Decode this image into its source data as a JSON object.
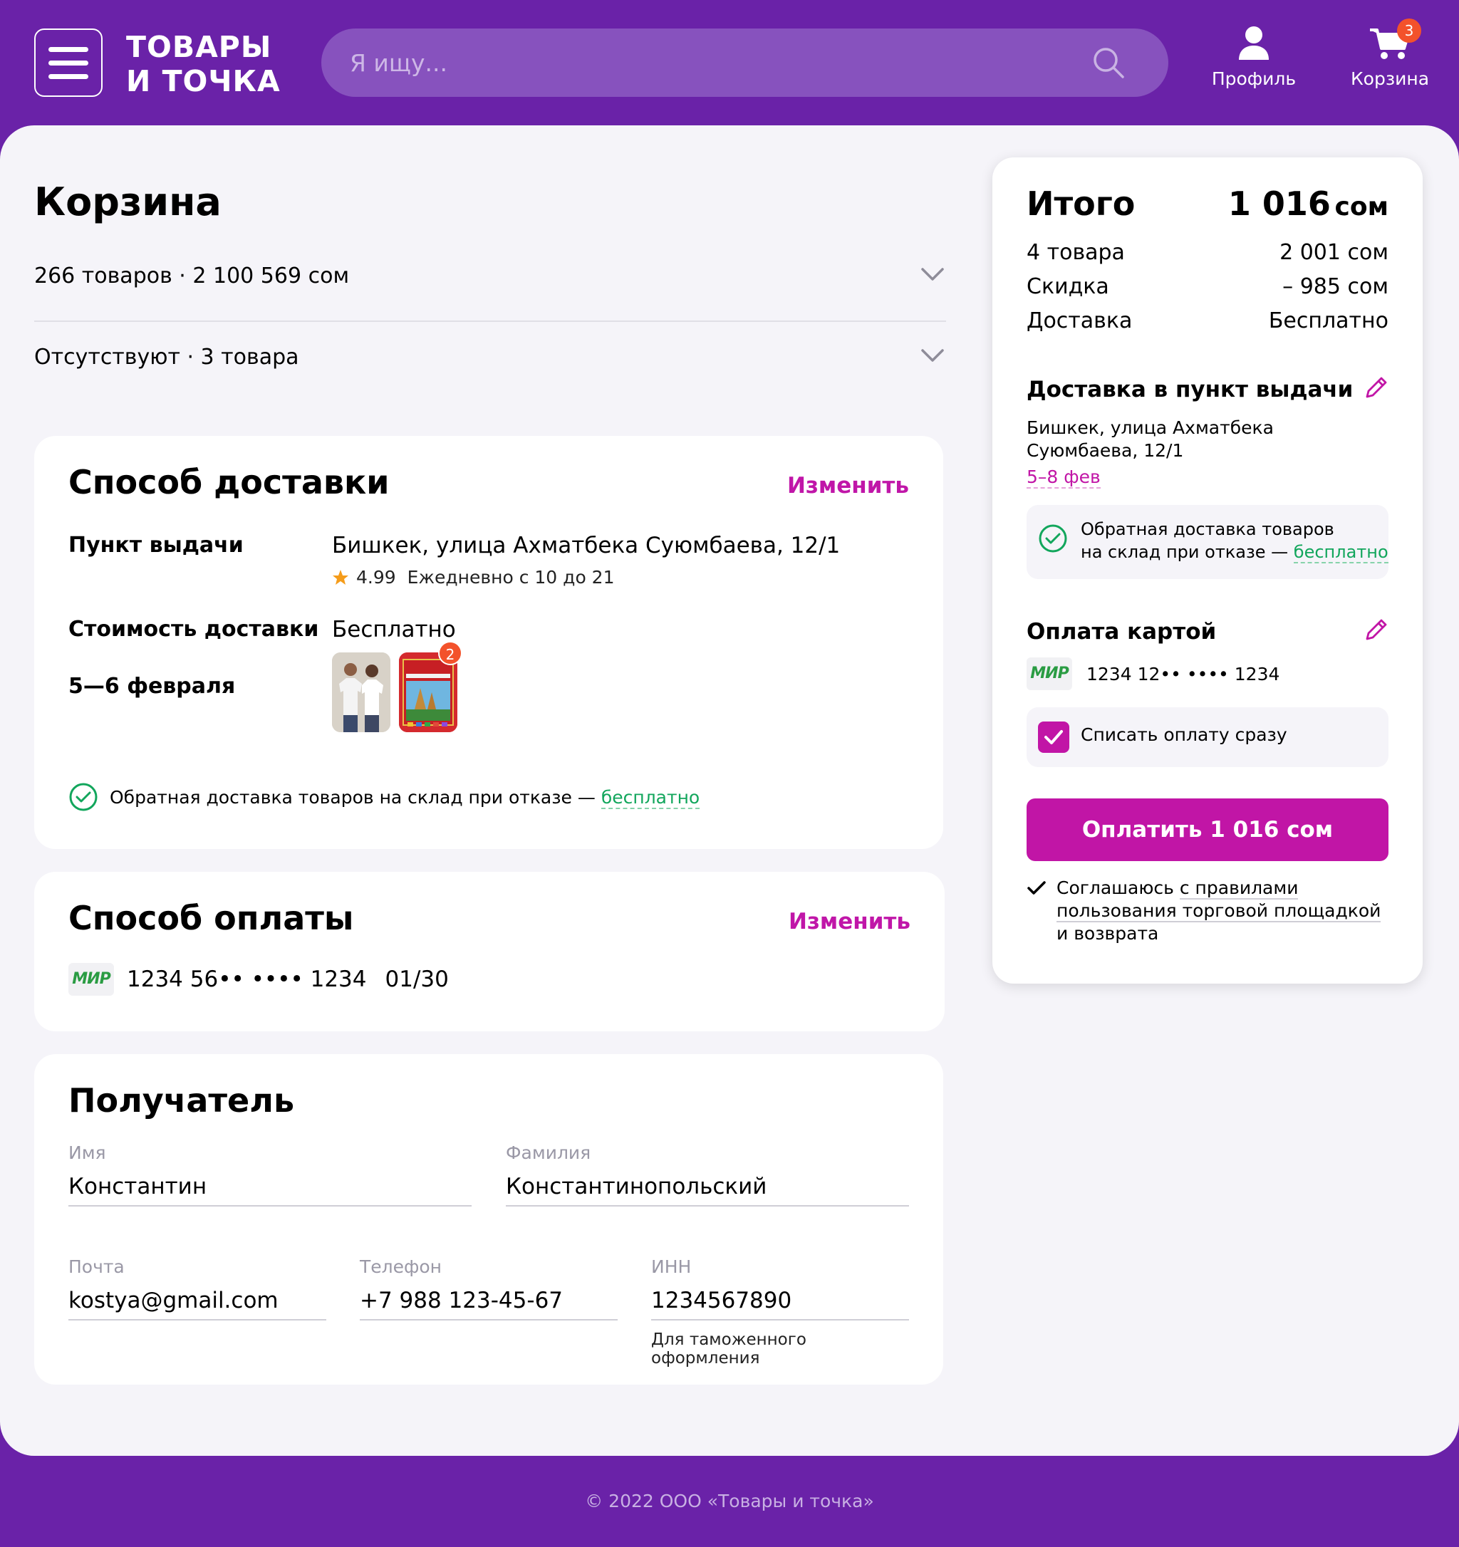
{
  "header": {
    "logo_line1": "ТОВАРЫ",
    "logo_line2": "И ТОЧКА",
    "search_placeholder": "Я ищу...",
    "profile_label": "Профиль",
    "cart_label": "Корзина",
    "cart_count": "3"
  },
  "cart": {
    "title": "Корзина",
    "summary_row": "266 товаров · 2 100 569 сом",
    "missing_row": "Отсутствуют · 3 товара"
  },
  "delivery": {
    "title": "Способ доставки",
    "change": "Изменить",
    "pickup_label": "Пункт выдачи",
    "pickup_address": "Бишкек, улица Ахматбека Суюмбаева, 12/1",
    "rating": "4.99",
    "hours": "Ежедневно с 10 до 21",
    "cost_label": "Стоимость доставки",
    "cost_value": "Бесплатно",
    "date_label": "5—6 февраля",
    "item_badge": "2",
    "return_text": "Обратная доставка товаров на склад при отказе — ",
    "return_free": "бесплатно"
  },
  "payment": {
    "title": "Способ оплаты",
    "change": "Изменить",
    "card_brand": "МИР",
    "card_number": "1234 56•• •••• 1234",
    "card_expiry": "01/30"
  },
  "recipient": {
    "title": "Получатель",
    "first_name_label": "Имя",
    "first_name": "Константин",
    "last_name_label": "Фамилия",
    "last_name": "Константинопольский",
    "email_label": "Почта",
    "email": "kostya@gmail.com",
    "phone_label": "Телефон",
    "phone": "+7 988 123-45-67",
    "inn_label": "ИНН",
    "inn": "1234567890",
    "inn_hint": "Для таможенного оформления"
  },
  "summary": {
    "total_label": "Итого",
    "total_value": "1 016",
    "total_currency": "сом",
    "items_label": "4 товара",
    "items_value": "2 001 сом",
    "discount_label": "Скидка",
    "discount_value": "– 985 сом",
    "delivery_label": "Доставка",
    "delivery_value": "Бесплатно",
    "pickup_title": "Доставка в пункт выдачи",
    "pickup_address": "Бишкек, улица Ахматбека Суюмбаева, 12/1",
    "pickup_dates": "5–8 фев",
    "return_line1": "Обратная доставка товаров",
    "return_line2": "на склад при отказе — ",
    "return_free": "бесплатно",
    "card_title": "Оплата картой",
    "card_brand": "МИР",
    "card_number": "1234 12•• •••• 1234",
    "charge_now": "Списать оплату сразу",
    "pay_button": "Оплатить 1 016 сом",
    "agree_1": "Соглашаюсь ",
    "agree_2": "с правилами",
    "agree_3": "пользования торговой площадкой",
    "agree_4": "и возврата"
  },
  "footer": {
    "copyright": "© 2022  ООО «Товары и точка»"
  },
  "colors": {
    "brand": "#6a22a8",
    "accent": "#c115a6",
    "green": "#12a65c",
    "badge": "#f3522b"
  }
}
